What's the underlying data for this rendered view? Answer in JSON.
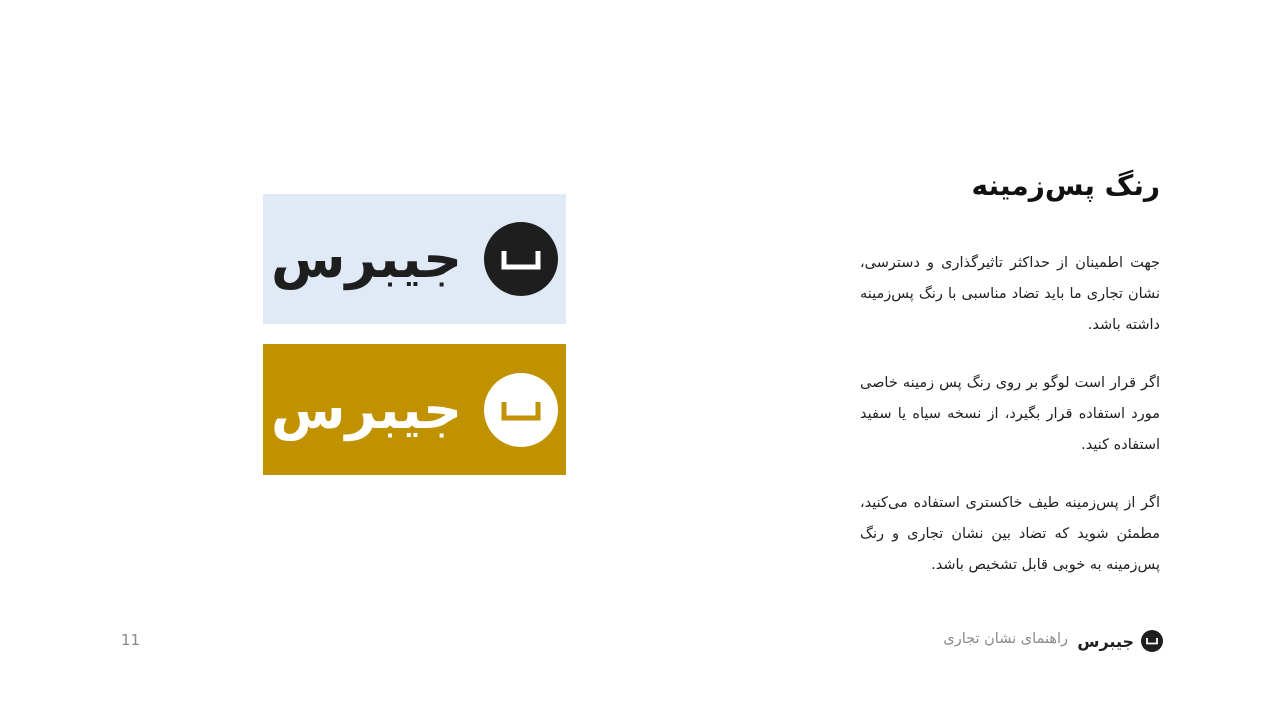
{
  "slide": {
    "heading": "رنگ پس‌زمینه",
    "paragraphs": [
      "جهت اطمینان از حداکثر تاثیرگذاری و دسترسی، نشان تجاری ما باید تضاد مناسبی با رنگ پس‌زمینه داشته باشد.",
      "اگر قرار است لوگو بر روی رنگ پس زمینه خاصی مورد استفاده قرار بگیرد، از نسخه سیاه یا سفید استفاده کنید.",
      "اگر از پس‌زمینه طیف خاکستری استفاده می‌کنید، مطمئن شوید که تضاد بین نشان تجاری و رنگ پس‌زمینه به خوبی قابل تشخیص باشد."
    ]
  },
  "logos": {
    "light_panel": {
      "wordmark": "جیبرس",
      "background": "#dfeaf6",
      "mark_color": "#1e1e1e",
      "icon": "cup-mark-icon"
    },
    "gold_panel": {
      "wordmark": "جیبرس",
      "background": "#c19200",
      "mark_color": "#ffffff",
      "icon": "cup-mark-icon"
    }
  },
  "footer": {
    "brand": "جیبرس",
    "subtitle": "راهنمای نشان تجاری",
    "page_number": "11"
  }
}
